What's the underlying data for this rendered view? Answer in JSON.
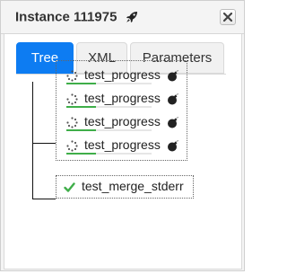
{
  "window": {
    "title": "Instance 111975",
    "title_icon": "rocket-icon",
    "close_icon": "close-icon"
  },
  "tabs": [
    {
      "label": "Tree",
      "active": true
    },
    {
      "label": "XML",
      "active": false
    },
    {
      "label": "Parameters",
      "active": false
    }
  ],
  "tree": {
    "group": [
      {
        "label": "test_progress",
        "status_icon": "spinner-icon",
        "action_icon": "bomb-icon",
        "progress": 0.35
      },
      {
        "label": "test_progress",
        "status_icon": "spinner-icon",
        "action_icon": "bomb-icon",
        "progress": 0.35
      },
      {
        "label": "test_progress",
        "status_icon": "spinner-icon",
        "action_icon": "bomb-icon",
        "progress": 0.35
      },
      {
        "label": "test_progress",
        "status_icon": "spinner-icon",
        "action_icon": "bomb-icon",
        "progress": 0.35
      }
    ],
    "final": {
      "label": "test_merge_stderr",
      "status_icon": "check-icon",
      "status": "success"
    }
  },
  "colors": {
    "accent": "#0d7cf2",
    "progress": "#3fae49",
    "success": "#3fae49"
  }
}
